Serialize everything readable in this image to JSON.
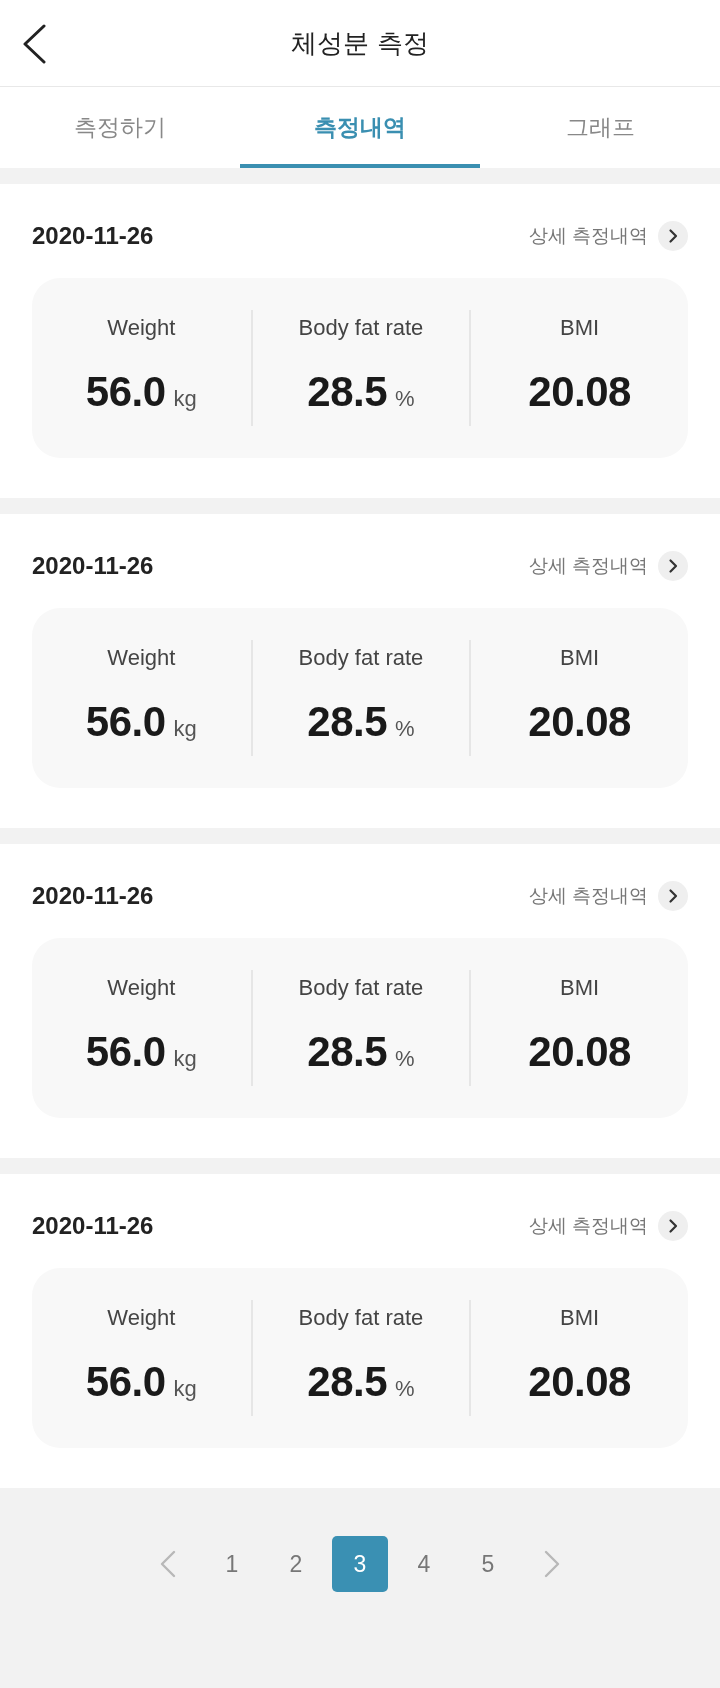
{
  "header": {
    "title": "체성분 측정"
  },
  "tabs": [
    {
      "label": "측정하기",
      "selected": false
    },
    {
      "label": "측정내역",
      "selected": true
    },
    {
      "label": "그래프",
      "selected": false
    }
  ],
  "records": [
    {
      "date": "2020-11-26",
      "detail_link": "상세 측정내역",
      "metrics": [
        {
          "label": "Weight",
          "value": "56.0",
          "unit": "kg"
        },
        {
          "label": "Body fat rate",
          "value": "28.5",
          "unit": "%"
        },
        {
          "label": "BMI",
          "value": "20.08"
        }
      ]
    },
    {
      "date": "2020-11-26",
      "detail_link": "상세 측정내역",
      "metrics": [
        {
          "label": "Weight",
          "value": "56.0",
          "unit": "kg"
        },
        {
          "label": "Body fat rate",
          "value": "28.5",
          "unit": "%"
        },
        {
          "label": "BMI",
          "value": "20.08"
        }
      ]
    },
    {
      "date": "2020-11-26",
      "detail_link": "상세 측정내역",
      "metrics": [
        {
          "label": "Weight",
          "value": "56.0",
          "unit": "kg"
        },
        {
          "label": "Body fat rate",
          "value": "28.5",
          "unit": "%"
        },
        {
          "label": "BMI",
          "value": "20.08"
        }
      ]
    },
    {
      "date": "2020-11-26",
      "detail_link": "상세 측정내역",
      "metrics": [
        {
          "label": "Weight",
          "value": "56.0",
          "unit": "kg"
        },
        {
          "label": "Body fat rate",
          "value": "28.5",
          "unit": "%"
        },
        {
          "label": "BMI",
          "value": "20.08"
        }
      ]
    }
  ],
  "pagination": {
    "pages": [
      {
        "label": "1",
        "selected": false
      },
      {
        "label": "2",
        "selected": false
      },
      {
        "label": "3",
        "selected": true
      },
      {
        "label": "4",
        "selected": false
      },
      {
        "label": "5",
        "selected": false
      }
    ]
  }
}
